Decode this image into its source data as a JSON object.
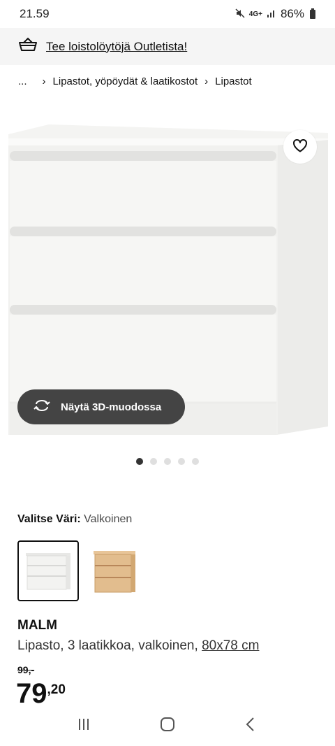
{
  "status": {
    "time": "21.59",
    "network": "4G+",
    "battery": "86%",
    "icons": [
      "mute-icon",
      "signal-icon",
      "battery-icon"
    ]
  },
  "promo": {
    "icon": "basket-icon",
    "text": "Tee loistolöytöjä Outletista!"
  },
  "breadcrumb": {
    "ellipsis": "...",
    "items": [
      "Lipastot, yöpöydät & laatikostot",
      "Lipastot"
    ]
  },
  "gallery": {
    "view_3d_label": "Näytä 3D-muodossa",
    "dot_count": 5,
    "active_dot": 0
  },
  "color": {
    "label": "Valitse Väri:",
    "value": "Valkoinen",
    "options": [
      {
        "name": "white",
        "selected": true,
        "hex": "#f3f3f1"
      },
      {
        "name": "oak",
        "selected": false,
        "hex": "#e2bd8e"
      }
    ]
  },
  "product": {
    "name": "MALM",
    "description": "Lipasto, 3 laatikkoa, valkoinen, ",
    "size": "80x78 cm",
    "old_price": "99,-",
    "price_int": "79",
    "price_dec": ",20"
  },
  "colors": {
    "dark_button": "#444444",
    "promo_bg": "#f5f5f5"
  }
}
